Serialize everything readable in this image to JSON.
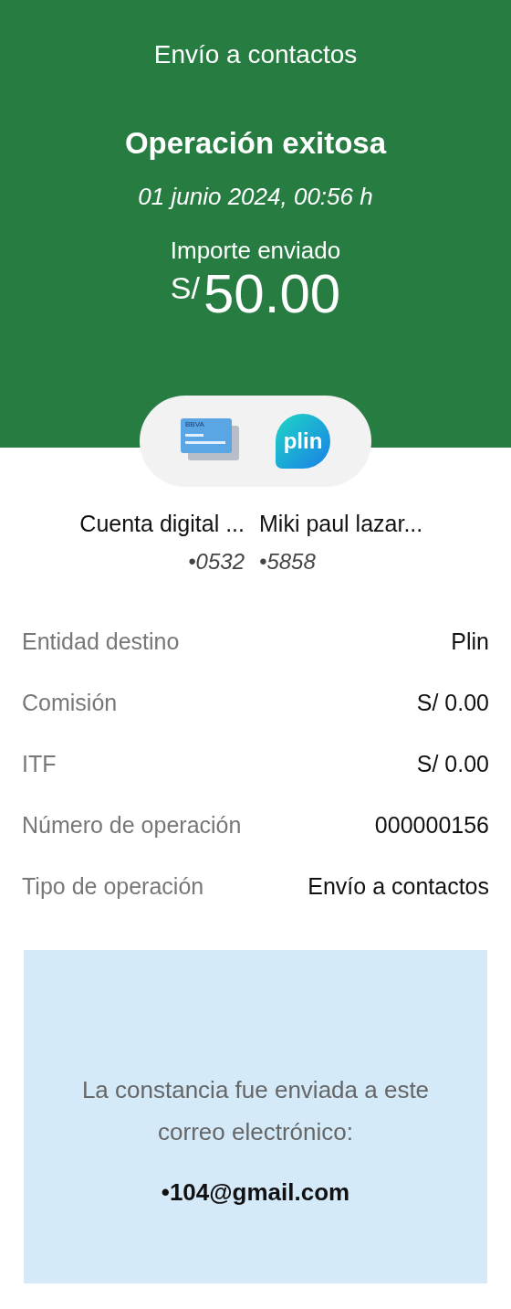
{
  "header": {
    "title": "Envío a contactos",
    "status": "Operación exitosa",
    "datetime": "01 junio 2024,  00:56 h",
    "amount_label": "Importe enviado",
    "currency": "S/",
    "amount": "50.00"
  },
  "logos": {
    "card_brand": "BBVA",
    "app_brand": "plin"
  },
  "accounts": [
    {
      "name": "Cuenta digital ...",
      "number": "•0532"
    },
    {
      "name": "Miki paul lazar...",
      "number": "•5858"
    }
  ],
  "details": [
    {
      "label": "Entidad destino",
      "value": "Plin"
    },
    {
      "label": "Comisión",
      "value": "S/ 0.00"
    },
    {
      "label": "ITF",
      "value": "S/ 0.00"
    },
    {
      "label": "Número de operación",
      "value": "000000156"
    },
    {
      "label": "Tipo de operación",
      "value": "Envío a contactos"
    }
  ],
  "notice": {
    "message": "La constancia fue enviada a este correo electrónico:",
    "email": "•104@gmail.com"
  }
}
